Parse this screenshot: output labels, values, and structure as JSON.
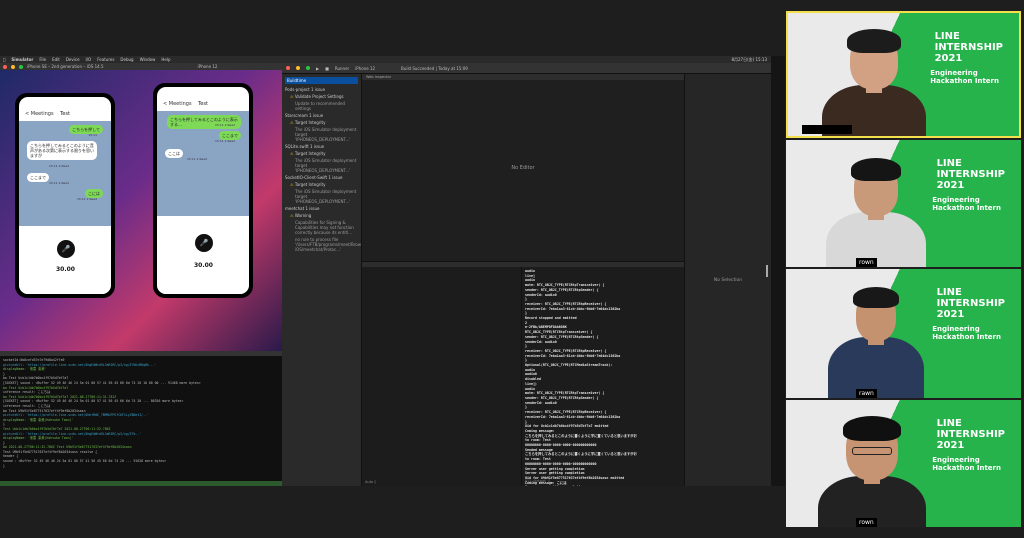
{
  "menubar": {
    "app": "Simulator",
    "items": [
      "File",
      "Edit",
      "Device",
      "I/O",
      "Features",
      "Debug",
      "Window",
      "Help"
    ],
    "clock": "8月27日(金) 15:13"
  },
  "simulator": {
    "title_left": "iPhone SE – 2nd generation – iOS 14.5",
    "title_right": "iPhone 12",
    "phone_left": {
      "back": "< Meetings",
      "title": "Test",
      "messages": [
        {
          "side": "right",
          "text": "こちらを押して",
          "time": "15:11"
        },
        {
          "side": "left",
          "text": "こちらを押してみるとこのように音声がある次第に表示する限りを思いますが",
          "time": "15:11 2 Read"
        },
        {
          "side": "left",
          "text": "ここまで",
          "time": "15:11 2 Read"
        },
        {
          "side": "right",
          "text": "こには",
          "time": "15:11 2 Read"
        }
      ],
      "timer": "30.00"
    },
    "phone_right": {
      "back": "< Meetings",
      "title": "Test",
      "messages": [
        {
          "side": "right",
          "text": "こちらを押してみるとこのように表示する…",
          "time": "15:11 2 Read"
        },
        {
          "side": "right",
          "text": "ここまで",
          "time": "15:11 2 Read"
        },
        {
          "side": "left",
          "text": "ここは",
          "time": "15:11 2 Read"
        }
      ],
      "timer": "30.00"
    }
  },
  "terminal": {
    "lines": [
      {
        "t": "socketId:0b8cefd57e7e79d8a42ffa9",
        "c": ""
      },
      {
        "t": "pictureUrl: 'https://profile.line-scdn.net/0hgEdWtd9L3aRIRC/p3/ng/E7bUcM8qBh...'",
        "c": "c"
      },
      {
        "t": "displayName: '東雲 柴美'",
        "c": "g"
      },
      {
        "t": "}",
        "c": ""
      },
      {
        "t": "bo Test Ucb1c1db7b0bc4f97b5d7bf7a7",
        "c": ""
      },
      {
        "t": "[SOCKET] sound : <Buffer 52 49 46 46 24 5a 01 00 57 41 56 45 66 6d 74 20 10 00 00 ... 91468 more bytes>",
        "c": ""
      },
      {
        "t": "bo Test Ucb1c1db7b0bc4f97b5d7bf7a7",
        "c": "g"
      },
      {
        "t": "inference result: こにちは",
        "c": ""
      },
      {
        "t": "bo Test Ucb1c1db7b0bc4f97b5d7bf7a7 2021-08-27T06:11:31.781Z",
        "c": "g"
      },
      {
        "t": "[SOCKET] sound : <Buffer 52 49 46 46 24 5a 01 00 57 41 56 45 66 6d 74 20 ... 86356 more bytes>",
        "c": ""
      },
      {
        "t": "inference result: こにちは",
        "c": ""
      },
      {
        "t": "bo Test U9b91f5e877517637eff4f9ef8b2034sasn",
        "c": ""
      },
      {
        "t": "pictureUrl: 'https://profile.line-scdn.net/0hhtMdE_7BMRUFPGfC6F1LyZB0etI/..'",
        "c": "c"
      },
      {
        "t": "displayName: '東雲 柴美(Kohsuke Toon)'",
        "c": "g"
      },
      {
        "t": "}",
        "c": ""
      },
      {
        "t": "Test Ucb1c1db7b0bc4f97b5d7bf7a7 2021-08-27T06:11:32.786Z",
        "c": "g"
      },
      {
        "t": "pictureUrl: 'https://profile.line-scdn.net/0hgEdWtd9L3aRIRC/p3/ng/E7b..'",
        "c": "c"
      },
      {
        "t": "displayName: '東雲 柴美(Kohsuke Toon)'",
        "c": "g"
      },
      {
        "t": "}",
        "c": ""
      },
      {
        "t": "bo 2021-08-27T06:11:32.786Z Test U9b91f5e877517637ef4f9ef8b2034sasn",
        "c": "g"
      },
      {
        "t": "Test U9b91f5e877517637ef4f9ef8b2034sasn resolve {",
        "c": ""
      },
      {
        "t": "  header {",
        "c": ""
      },
      {
        "t": "  sound : <Buffer 52 49 46 46 24 5a 01 00 57 41 56 45 66 6d 74 20 ... 91628 more bytes>",
        "c": ""
      },
      {
        "t": "}",
        "c": ""
      }
    ]
  },
  "xcode": {
    "toolbar": [
      "Runner",
      "iPhone 12",
      "Build Succeeded | Today at 15:09",
      "Web Inspector"
    ],
    "tabs": [
      "Pods-project  1 issue"
    ],
    "navigator": [
      {
        "text": "Pods-project 1 issue",
        "level": 0,
        "warn": false
      },
      {
        "text": "Validate Project Settings",
        "level": 1,
        "warn": true
      },
      {
        "text": "Update to recommended settings",
        "level": 2,
        "warn": false
      },
      {
        "text": "Starscream 1 issue",
        "level": 0,
        "warn": false
      },
      {
        "text": "Target Integrity",
        "level": 1,
        "warn": true
      },
      {
        "text": "The iOS Simulator deployment target 'IPHONEOS_DEPLOYMENT...'",
        "level": 2,
        "warn": false
      },
      {
        "text": "SQLite.swift 1 issue",
        "level": 0,
        "warn": false
      },
      {
        "text": "Target Integrity",
        "level": 1,
        "warn": true
      },
      {
        "text": "The iOS Simulator deployment target 'IPHONEOS_DEPLOYMENT...'",
        "level": 2,
        "warn": false
      },
      {
        "text": "SocketIO-Client-Swift 1 issue",
        "level": 0,
        "warn": false
      },
      {
        "text": "Target Integrity",
        "level": 1,
        "warn": true
      },
      {
        "text": "The iOS Simulator deployment target 'IPHONEOS_DEPLOYMENT...'",
        "level": 2,
        "warn": false
      },
      {
        "text": "meetchat 1 issue",
        "level": 0,
        "warn": false
      },
      {
        "text": "Warning",
        "level": 1,
        "warn": true
      },
      {
        "text": "Capabilities for Signing & Capabilities may not function correctly because its entitl...",
        "level": 2,
        "warn": false
      },
      {
        "text": "no rule to process file '/Users/FTB/programs/meet/Brown-iOS/meetchat/Protoc...'",
        "level": 2,
        "warn": false
      }
    ],
    "no_editor": "No Editor",
    "no_selection": "No Selection",
    "var_footer": "Auto ◊",
    "console_footer": "All Output ◊",
    "console": [
      "audio",
      "live]",
      "audio",
      "mute: RTC_OBJC_TYPE(RTCRtpTransceiver) {",
      "  sender: RTC_OBJC_TYPE(RTCRtpSender) {",
      "  senderId: audio0",
      "}",
      "  receiver: RTC_OBJC_TYPE(RTCRtpReceiver) {",
      "  receiverId: 7eba1aa3-81cb-4bbc-9bb6-7e04dc1362ba",
      "}",
      "",
      "Record stopped and emitted",
      "2",
      "e-2FBb/ABEMPDFDAbB8BK",
      "RTC_OBJC_TYPE(RTCRtpTransceiver) {",
      "  sender: RTC_OBJC_TYPE(RTCRtpSender) {",
      "  senderId: audio0",
      "}",
      "  receiver: RTC_OBJC_TYPE(RTCRtpReceiver) {",
      "  receiverId: 7eba1aa3-81cb-4bbc-9bb6-7e04dc1362ba",
      "}",
      "",
      "Optional(RTC_OBJC_TYPE(RTCMediaStreamTrack):",
      "audio",
      "audio0",
      "disabled",
      "live])",
      "audio",
      "mute: RTC_OBJC_TYPE(RTCRtpTransceiver) {",
      "  sender: RTC_OBJC_TYPE(RTCRtpSender) {",
      "  senderId: audio0",
      "}",
      "  receiver: RTC_OBJC_TYPE(RTCRtpReceiver) {",
      "  receiverId: 7eba1aa3-81cb-4bbc-9bb6-7e04dc1362ba",
      "}",
      "",
      "Uid for Ucb1c1db7b0bc4f97b5d7bf7a7 emitted",
      "Coming message:",
      "  こちらを押してみるとこのように書くように字に置くていると思いますがお",
      "  to room: Test",
      "00000000-0000-0000-0000-000000000000",
      "Sended message",
      "  こちらを押してみるとこのように書くように字に置くていると思いますがお",
      "  to room: Test",
      "00000000-0000-0000-0000-000000000000",
      "Server user getting completion",
      "Server user getting completion",
      "Uid for U9b91f5e877517637ef4f9ef8b2034sasn emitted",
      "Coming message: こには",
      "Server user getting completion",
      "Server user getting completion",
      "Coming message: ここは",
      "Server user getting completion",
      "Server user getting completion"
    ]
  },
  "participants": [
    {
      "brand_line1": "LINE",
      "brand_line2": "INTERNSHIP",
      "brand_line3": "2021",
      "sub_line1": "Engineering",
      "sub_line2": "Hackathon Intern",
      "name": "",
      "active": true
    },
    {
      "brand_line1": "LINE",
      "brand_line2": "INTERNSHIP",
      "brand_line3": "2021",
      "sub_line1": "Engineering",
      "sub_line2": "Hackathon Intern",
      "name": "rown",
      "active": false
    },
    {
      "brand_line1": "LINE",
      "brand_line2": "INTERNSHIP",
      "brand_line3": "2021",
      "sub_line1": "Engineering",
      "sub_line2": "Hackathon Intern",
      "name": "rawn",
      "active": false
    },
    {
      "brand_line1": "LINE",
      "brand_line2": "INTERNSHIP",
      "brand_line3": "2021",
      "sub_line1": "Engineering",
      "sub_line2": "Hackathon Intern",
      "name": "rown",
      "active": false
    }
  ]
}
